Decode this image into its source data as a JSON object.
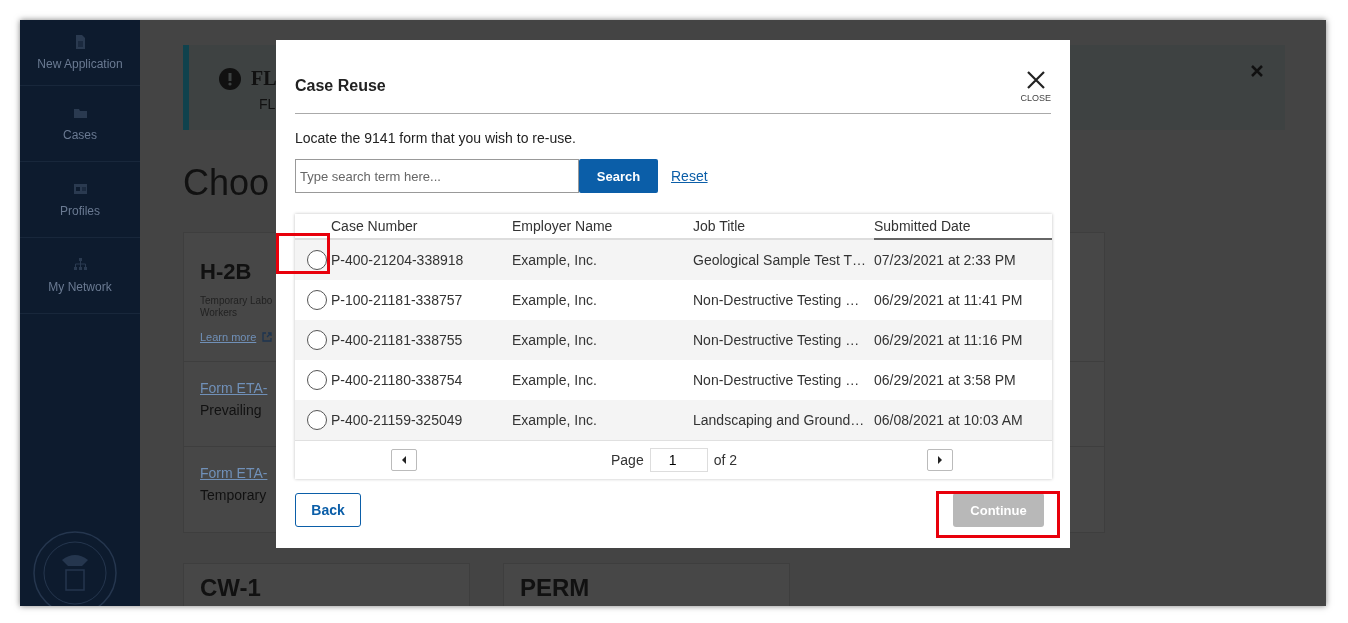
{
  "sidebar": {
    "items": [
      {
        "label": "New Application"
      },
      {
        "label": "Cases"
      },
      {
        "label": "Profiles"
      },
      {
        "label": "My Network"
      }
    ]
  },
  "banner": {
    "title": "FL",
    "text": "FL"
  },
  "page": {
    "heading": "Choo",
    "cards": [
      {
        "title": "H-2B",
        "subtitle_lines": [
          "Temporary Labo",
          "Workers"
        ],
        "learn_more": "Learn more",
        "forms": [
          {
            "link": "Form ETA-",
            "description": "Prevailing"
          },
          {
            "link": "Form ETA-",
            "description": "Temporary"
          }
        ]
      },
      {
        "title": "CW-1"
      },
      {
        "title": "PERM"
      }
    ]
  },
  "modal": {
    "title": "Case Reuse",
    "close_label": "CLOSE",
    "instruction": "Locate the 9141 form that you wish to re-use.",
    "search": {
      "placeholder": "Type search term here...",
      "button": "Search",
      "reset": "Reset"
    },
    "table": {
      "columns": [
        "Case Number",
        "Employer Name",
        "Job Title",
        "Submitted Date"
      ],
      "rows": [
        {
          "selected": false,
          "highlighted": true,
          "cells": [
            "P-400-21204-338918",
            "Example, Inc.",
            "Geological Sample Test T…",
            "07/23/2021 at 2:33 PM"
          ]
        },
        {
          "selected": false,
          "highlighted": false,
          "cells": [
            "P-100-21181-338757",
            "Example, Inc.",
            "Non-Destructive Testing …",
            "06/29/2021 at 11:41 PM"
          ]
        },
        {
          "selected": false,
          "highlighted": false,
          "cells": [
            "P-400-21181-338755",
            "Example, Inc.",
            "Non-Destructive Testing …",
            "06/29/2021 at 11:16 PM"
          ]
        },
        {
          "selected": false,
          "highlighted": false,
          "cells": [
            "P-400-21180-338754",
            "Example, Inc.",
            "Non-Destructive Testing …",
            "06/29/2021 at 3:58 PM"
          ]
        },
        {
          "selected": false,
          "highlighted": false,
          "cells": [
            "P-400-21159-325049",
            "Example, Inc.",
            "Landscaping and Ground…",
            "06/08/2021 at 10:03 AM"
          ]
        }
      ]
    },
    "pagination": {
      "label": "Page",
      "value": "1",
      "total": "of 2"
    },
    "back": "Back",
    "continue": {
      "label": "Continue",
      "disabled": true,
      "highlighted": true
    }
  }
}
